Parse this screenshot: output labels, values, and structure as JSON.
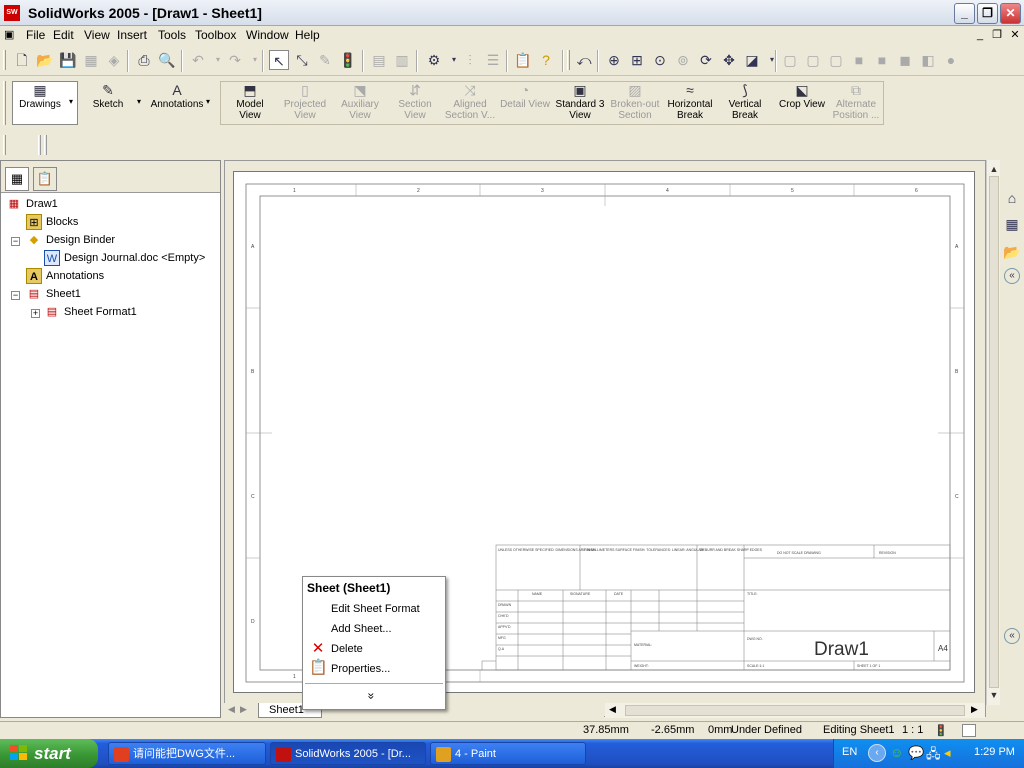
{
  "window": {
    "title": "SolidWorks 2005 - [Draw1 - Sheet1]",
    "app_icon": "solidworks-icon"
  },
  "menu": [
    "File",
    "Edit",
    "View",
    "Insert",
    "Tools",
    "Toolbox",
    "Window",
    "Help"
  ],
  "command_manager": {
    "groups": [
      {
        "label": "Drawings"
      },
      {
        "label": "Sketch"
      },
      {
        "label": "Annotations"
      }
    ],
    "commands": [
      {
        "line1": "Model",
        "line2": "View",
        "enabled": true
      },
      {
        "line1": "Projected",
        "line2": "View",
        "enabled": false
      },
      {
        "line1": "Auxiliary",
        "line2": "View",
        "enabled": false
      },
      {
        "line1": "Section",
        "line2": "View",
        "enabled": false
      },
      {
        "line1": "Aligned",
        "line2": "Section V...",
        "enabled": false
      },
      {
        "line1": "Detail View",
        "line2": "",
        "enabled": false
      },
      {
        "line1": "Standard 3",
        "line2": "View",
        "enabled": true
      },
      {
        "line1": "Broken-out",
        "line2": "Section",
        "enabled": false
      },
      {
        "line1": "Horizontal",
        "line2": "Break",
        "enabled": true
      },
      {
        "line1": "Vertical",
        "line2": "Break",
        "enabled": true
      },
      {
        "line1": "Crop View",
        "line2": "",
        "enabled": true
      },
      {
        "line1": "Alternate",
        "line2": "Position ...",
        "enabled": false
      }
    ]
  },
  "tree": {
    "root": "Draw1",
    "items": [
      {
        "label": "Blocks"
      },
      {
        "label": "Design Binder"
      },
      {
        "label": "Design Journal.doc <Empty>"
      },
      {
        "label": "Annotations"
      },
      {
        "label": "Sheet1"
      },
      {
        "label": "Sheet Format1"
      }
    ]
  },
  "drawing": {
    "col_labels": [
      "1",
      "2",
      "3",
      "4",
      "5",
      "6"
    ],
    "row_labels": [
      "A",
      "B",
      "C",
      "D"
    ],
    "title_block": {
      "notes": "UNLESS OTHERWISE SPECIFIED: DIMENSIONS ARE IN MILLIMETERS SURFACE FINISH: TOLERANCES: LINEAR: ANGULAR:",
      "finish": "FINISH",
      "deburr": "DEBURR AND BREAK SHARP EDGES",
      "do_not_scale": "DO NOT SCALE DRAWING",
      "revision": "REVISION",
      "name": "NAME",
      "signature": "SIGNATURE",
      "date": "DATE",
      "drawn": "DRAWN",
      "chkd": "CHK'D",
      "appvd": "APPV'D",
      "mfg": "MFG",
      "qa": "Q.A",
      "title": "TITLE:",
      "material": "MATERIAL:",
      "weight": "WEIGHT:",
      "dwg_no": "DWG NO.",
      "drawing_name": "Draw1",
      "size": "A4",
      "scale": "SCALE:1:1",
      "sheet": "SHEET 1 OF 1"
    }
  },
  "context_menu": {
    "header": "Sheet (Sheet1)",
    "items": [
      "Edit Sheet Format",
      "Add Sheet...",
      "Delete",
      "Properties..."
    ],
    "more": "»"
  },
  "sheet_tab": "Sheet1",
  "status": {
    "x": "37.85mm",
    "y": "-2.65mm",
    "z": "0mm",
    "state": "Under Defined",
    "editing": "Editing Sheet1",
    "scale": "1 : 1"
  },
  "taskbar": {
    "start": "start",
    "tasks": [
      {
        "label": "请问能把DWG文件...",
        "color": "#e04020"
      },
      {
        "label": "SolidWorks 2005 - [Dr...",
        "color": "#c01010"
      },
      {
        "label": "4 - Paint",
        "color": "#e0a020"
      }
    ],
    "lang": "EN",
    "time": "1:29 PM"
  }
}
